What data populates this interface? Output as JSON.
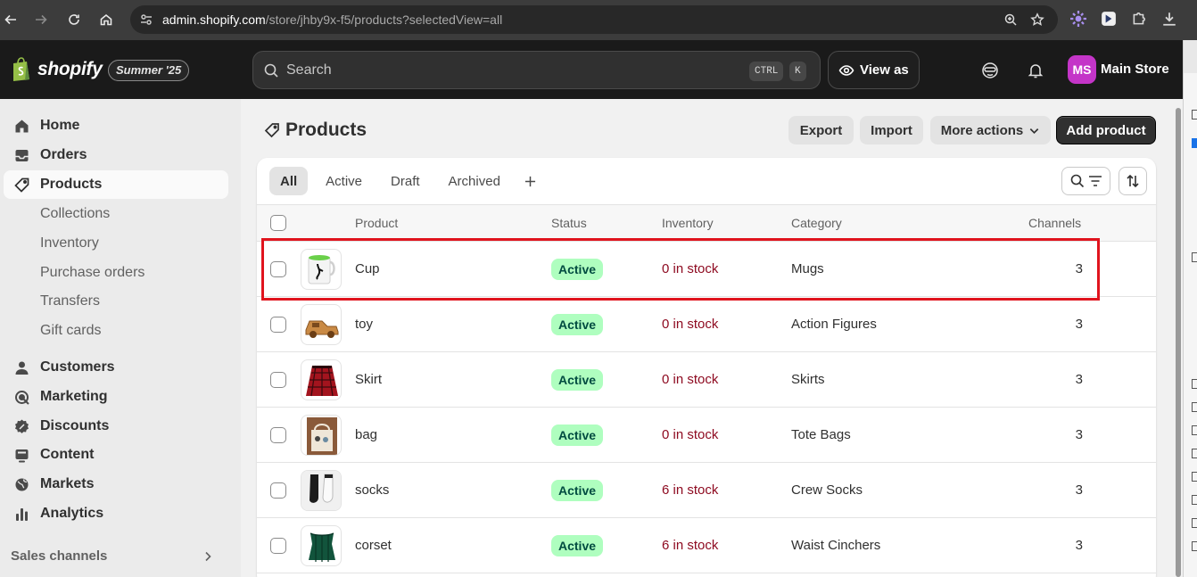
{
  "browser": {
    "url_host": "admin.shopify.com",
    "url_path": "/store/jhby9x-f5/products?selectedView=all"
  },
  "header": {
    "logo_text": "shopify",
    "edition": "Summer '25",
    "search_placeholder": "Search",
    "shortcut_ctrl": "CTRL",
    "shortcut_k": "K",
    "view_as": "View as",
    "avatar_initials": "MS",
    "store_name": "Main Store",
    "avatar_color": "#c435c8"
  },
  "sidebar": {
    "items": [
      {
        "label": "Home",
        "icon": "home-icon"
      },
      {
        "label": "Orders",
        "icon": "inbox-icon"
      },
      {
        "label": "Products",
        "icon": "tag-icon",
        "active": true
      },
      {
        "label": "Customers",
        "icon": "person-icon"
      },
      {
        "label": "Marketing",
        "icon": "target-icon"
      },
      {
        "label": "Discounts",
        "icon": "discount-icon"
      },
      {
        "label": "Content",
        "icon": "content-icon"
      },
      {
        "label": "Markets",
        "icon": "globe-icon"
      },
      {
        "label": "Analytics",
        "icon": "bar-chart-icon"
      }
    ],
    "product_subitems": [
      "Collections",
      "Inventory",
      "Purchase orders",
      "Transfers",
      "Gift cards"
    ],
    "sales_channels": "Sales channels"
  },
  "page": {
    "title": "Products",
    "export": "Export",
    "import": "Import",
    "more_actions": "More actions",
    "add_product": "Add product"
  },
  "tabs": [
    "All",
    "Active",
    "Draft",
    "Archived"
  ],
  "table": {
    "columns": [
      "Product",
      "Status",
      "Inventory",
      "Category",
      "Channels"
    ],
    "rows": [
      {
        "product": "Cup",
        "status": "Active",
        "inventory": "0 in stock",
        "category": "Mugs",
        "channels": "3"
      },
      {
        "product": "toy",
        "status": "Active",
        "inventory": "0 in stock",
        "category": "Action Figures",
        "channels": "3"
      },
      {
        "product": "Skirt",
        "status": "Active",
        "inventory": "0 in stock",
        "category": "Skirts",
        "channels": "3"
      },
      {
        "product": "bag",
        "status": "Active",
        "inventory": "0 in stock",
        "category": "Tote Bags",
        "channels": "3"
      },
      {
        "product": "socks",
        "status": "Active",
        "inventory": "6 in stock",
        "category": "Crew Socks",
        "channels": "3"
      },
      {
        "product": "corset",
        "status": "Active",
        "inventory": "6 in stock",
        "category": "Waist Cinchers",
        "channels": "3"
      }
    ]
  },
  "colors": {
    "status_badge_bg": "#affebf",
    "status_badge_text": "#014b40",
    "stock_text": "#8e0b21",
    "highlight": "#e0141e"
  }
}
